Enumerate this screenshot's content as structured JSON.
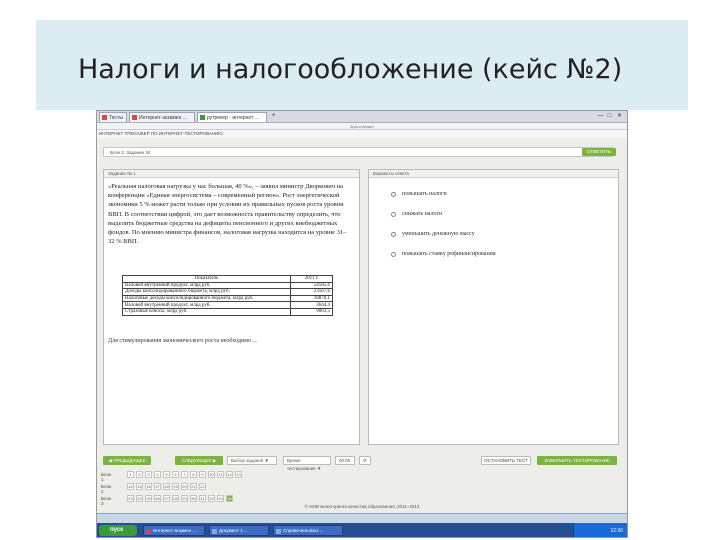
{
  "slide": {
    "title": "Налоги и налогообложение (кейс №2)"
  },
  "browser": {
    "tabs": [
      {
        "label": "Тесты",
        "icon": "page-icon"
      },
      {
        "label": "Интернет-экзамен ...",
        "icon": "page-icon"
      },
      {
        "label": "рутрекер - интернет ...",
        "icon": "page-icon"
      }
    ],
    "new_tab": "+",
    "minimize": "—",
    "maximize": "□",
    "close": "✕",
    "url": "fepo.ru/exam",
    "bookmarks_text": "ИНТЕРНЕТ ТРЕНАЖЕР ПО ИНТЕРНЕТ-ТЕСТИРОВАНИЮ"
  },
  "question_bar": {
    "label": "Блок 3. Задание 34",
    "button": "ОТВЕТИТЬ"
  },
  "left_panel": {
    "header": "Задание № 1",
    "text": "«Реальная налоговая нагрузка у нас большая, 40 %», – заявил министр Дворкович на конференции «Единая энергосистема – современный регион». Рост энергетической экономики 5 % может расти только при условии их правильных пусков роста уровня ВВП. В соответствии цифрой, это дает возможность правительству определить, что выделить бюджетные средства на дефициты пенсионного и других внебюджетных фондов. По мнению министра финансов, налоговая нагрузка находится на уровне 31–32 % ВВП.",
    "table": {
      "headers": [
        "Показатель",
        "2011 г."
      ],
      "rows": [
        [
          "Валовой внутренний продукт, млрд руб.",
          "54585,6"
        ],
        [
          "Доходы консолидированного бюджета, млрд руб.",
          "23567,6"
        ],
        [
          "Налоговые доходы консолидированного бюджета, млрд руб.",
          "18870,1"
        ],
        [
          "Валовой внутренний продукт, млрд руб.",
          "3644,4"
        ],
        [
          "Страховые взносы, млрд руб.",
          "9063,5"
        ]
      ]
    },
    "question": "Для стимулирования экономического роста необходимо ..."
  },
  "right_panel": {
    "header": "Варианты ответа",
    "options": [
      "повышать налоги",
      "снижать налоги",
      "уменьшить денежную массу",
      "повышать ставку рефинансирования"
    ]
  },
  "controls": {
    "prev": "◀ ПРЕДЫДУЩЕЕ",
    "next": "СЛЕДУЮЩЕЕ ▶",
    "select_value": "Выбор задания ▼",
    "select_value_2": "Время тестирования ▼",
    "time": "00:00",
    "refresh_icon": "⟳",
    "stop": "ОСТАНОВИТЬ ТЕСТ",
    "finish": "ЗАВЕРШИТЬ ТЕСТИРОВАНИЕ"
  },
  "blocks": [
    {
      "label": "Блок 1",
      "numbers": [
        "1",
        "2",
        "3",
        "4",
        "5",
        "6",
        "7",
        "8",
        "9",
        "10",
        "11",
        "12",
        "13"
      ]
    },
    {
      "label": "Блок 2",
      "numbers": [
        "14",
        "15",
        "16",
        "17",
        "18",
        "19",
        "20",
        "21",
        "22"
      ]
    },
    {
      "label": "Блок 3",
      "numbers": [
        "23",
        "24",
        "25",
        "26",
        "27",
        "28",
        "29",
        "30",
        "31",
        "32",
        "33",
        "34"
      ]
    }
  ],
  "footer": "© НИИ мониторинга качества образования, 2011–2013",
  "taskbar": {
    "start": "пуск",
    "items": [
      "Интернет-экзамен ...",
      "Документ 1 ...",
      "Справочник.docx ..."
    ],
    "clock": "12:30"
  }
}
